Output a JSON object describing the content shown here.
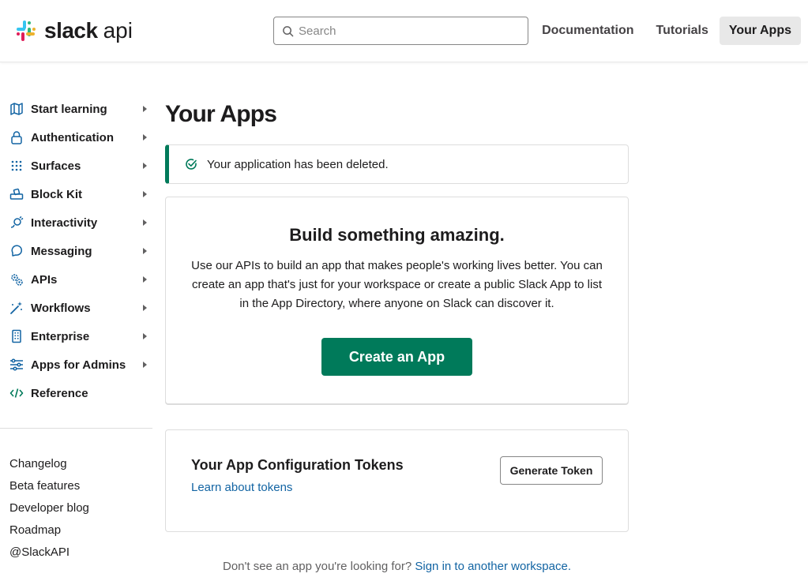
{
  "header": {
    "logo_word": "slack",
    "logo_suffix": "api",
    "search_placeholder": "Search",
    "nav": [
      {
        "label": "Documentation"
      },
      {
        "label": "Tutorials"
      },
      {
        "label": "Your Apps",
        "active": true
      }
    ]
  },
  "sidebar": {
    "items": [
      {
        "label": "Start learning",
        "icon": "book-map-icon"
      },
      {
        "label": "Authentication",
        "icon": "lock-icon"
      },
      {
        "label": "Surfaces",
        "icon": "grid-dots-icon"
      },
      {
        "label": "Block Kit",
        "icon": "blocks-icon"
      },
      {
        "label": "Interactivity",
        "icon": "plug-icon"
      },
      {
        "label": "Messaging",
        "icon": "chat-icon"
      },
      {
        "label": "APIs",
        "icon": "gears-icon"
      },
      {
        "label": "Workflows",
        "icon": "magic-wand-icon"
      },
      {
        "label": "Enterprise",
        "icon": "building-icon"
      },
      {
        "label": "Apps for Admins",
        "icon": "sliders-icon"
      },
      {
        "label": "Reference",
        "icon": "code-icon"
      }
    ],
    "links": [
      "Changelog",
      "Beta features",
      "Developer blog",
      "Roadmap",
      "@SlackAPI"
    ]
  },
  "main": {
    "title": "Your Apps",
    "alert": "Your application has been deleted.",
    "build_card": {
      "heading": "Build something amazing.",
      "body": "Use our APIs to build an app that makes people's working lives better. You can create an app that's just for your workspace or create a public Slack App to list in the App Directory, where anyone on Slack can discover it.",
      "button": "Create an App"
    },
    "tokens_card": {
      "heading": "Your App Configuration Tokens",
      "link": "Learn about tokens",
      "button": "Generate Token"
    },
    "footer": {
      "text": "Don't see an app you're looking for? ",
      "link": "Sign in to another workspace."
    }
  },
  "colors": {
    "primary_green": "#007a5a",
    "link_blue": "#1264a3",
    "icon_blue": "#1264a3",
    "icon_green": "#007a5a"
  }
}
